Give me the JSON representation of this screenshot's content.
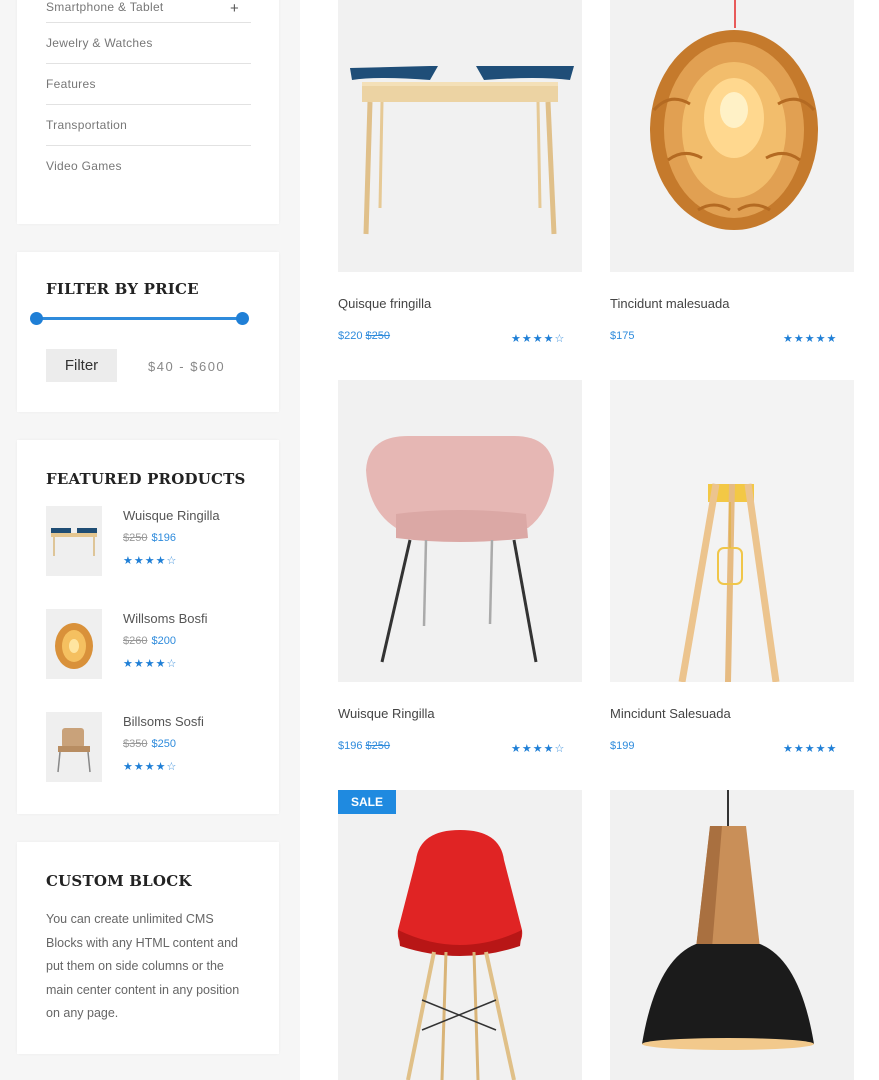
{
  "categories": [
    {
      "label": "Smartphone & Tablet",
      "expand": "+"
    },
    {
      "label": "Jewelry & Watches"
    },
    {
      "label": "Features"
    },
    {
      "label": "Transportation"
    },
    {
      "label": "Video Games"
    }
  ],
  "filter": {
    "title": "FILTER BY PRICE",
    "button_label": "Filter",
    "range_text": "$40 - $600",
    "min_value": 40,
    "max_value": 600
  },
  "featured": {
    "title": "FEATURED PRODUCTS",
    "items": [
      {
        "name": "Wuisque Ringilla",
        "old_price": "$250",
        "price": "$196",
        "rating": 4,
        "image": "desk"
      },
      {
        "name": "Willsoms Bosfi",
        "old_price": "$260",
        "price": "$200",
        "rating": 4,
        "image": "pendant-lamp"
      },
      {
        "name": "Billsoms Sosfi",
        "old_price": "$350",
        "price": "$250",
        "rating": 4,
        "image": "chair"
      }
    ]
  },
  "custom_block": {
    "title": "CUSTOM BLOCK",
    "text": "You can create unlimited CMS Blocks with any HTML content and put them on side columns or the main center content in any position on any page."
  },
  "products": [
    {
      "name": "Quisque fringilla",
      "price": "$220",
      "old_price": "$250",
      "rating": 4,
      "image": "desk"
    },
    {
      "name": "Tincidunt malesuada",
      "price": "$175",
      "old_price": "",
      "rating": 5,
      "image": "pendant-lamp"
    },
    {
      "name": "Wuisque Ringilla",
      "price": "$196",
      "old_price": "$250",
      "rating": 4,
      "image": "pink-chair"
    },
    {
      "name": "Mincidunt Salesuada",
      "price": "$199",
      "old_price": "",
      "rating": 5,
      "image": "floor-lamp"
    },
    {
      "name": "",
      "price": "",
      "old_price": "",
      "badge": "SALE",
      "image": "red-chair"
    },
    {
      "name": "",
      "price": "",
      "old_price": "",
      "image": "black-pendant"
    }
  ],
  "colors": {
    "accent": "#1f8ae0",
    "sidebar_bg": "#f6f6f6",
    "image_bg": "#f1f1f1"
  }
}
